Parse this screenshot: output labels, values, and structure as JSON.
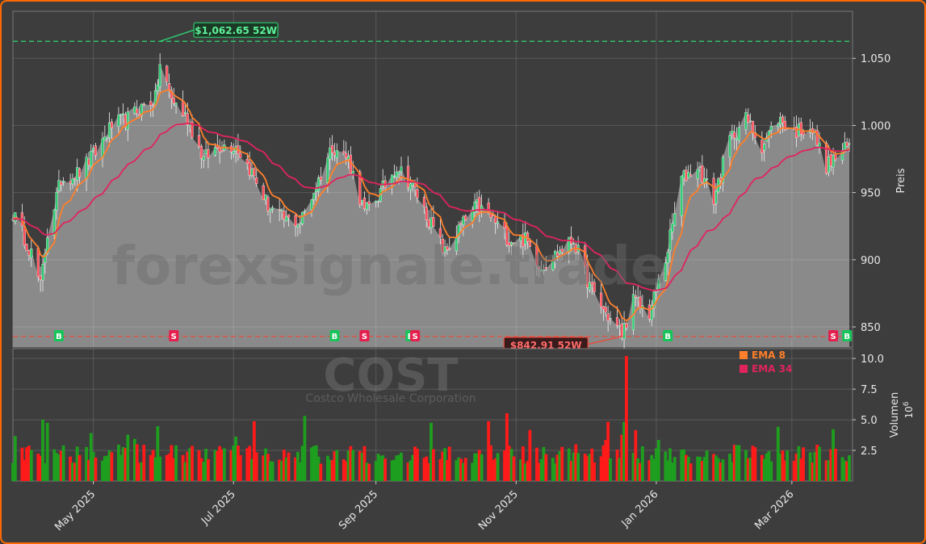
{
  "chart_data": {
    "type": "candlestick",
    "watermark": "forexsignale.trade",
    "ticker": "COST",
    "company": "Costco Wholesale Corporation",
    "price_axis": {
      "label": "Preis",
      "ylim": [
        835,
        1085
      ],
      "ticks": [
        850,
        900,
        950,
        1000,
        1050
      ],
      "tick_labels": [
        "850",
        "900",
        "950",
        "1.000",
        "1.050"
      ]
    },
    "volume_axis": {
      "label": "Volumen",
      "multiplier": "10",
      "multiplier_exp": "6",
      "ylim": [
        0,
        10.8
      ],
      "ticks": [
        2.5,
        5.0,
        7.5,
        10.0
      ],
      "tick_labels": [
        "2.5",
        "5.0",
        "7.5",
        "10.0"
      ]
    },
    "x_axis": {
      "start": "2025-03-27",
      "end": "2026-03-26",
      "ticks": [
        {
          "date": "2025-05-01",
          "label": "May 2025"
        },
        {
          "date": "2025-07-01",
          "label": "Jul 2025"
        },
        {
          "date": "2025-09-01",
          "label": "Sep 2025"
        },
        {
          "date": "2025-11-01",
          "label": "Nov 2025"
        },
        {
          "date": "2026-01-01",
          "label": "Jan 2026"
        },
        {
          "date": "2026-03-01",
          "label": "Mar 2026"
        }
      ]
    },
    "anchors": [
      [
        "2025-03-27",
        935
      ],
      [
        "2025-04-04",
        905
      ],
      [
        "2025-04-08",
        880
      ],
      [
        "2025-04-11",
        920
      ],
      [
        "2025-04-17",
        960
      ],
      [
        "2025-04-25",
        965
      ],
      [
        "2025-05-02",
        980
      ],
      [
        "2025-05-09",
        1000
      ],
      [
        "2025-05-16",
        1005
      ],
      [
        "2025-05-23",
        1015
      ],
      [
        "2025-05-28",
        1020
      ],
      [
        "2025-05-30",
        1045
      ],
      [
        "2025-06-04",
        1020
      ],
      [
        "2025-06-11",
        1005
      ],
      [
        "2025-06-18",
        975
      ],
      [
        "2025-06-25",
        985
      ],
      [
        "2025-07-02",
        985
      ],
      [
        "2025-07-09",
        965
      ],
      [
        "2025-07-16",
        940
      ],
      [
        "2025-07-23",
        930
      ],
      [
        "2025-07-30",
        928
      ],
      [
        "2025-08-06",
        955
      ],
      [
        "2025-08-13",
        985
      ],
      [
        "2025-08-20",
        975
      ],
      [
        "2025-08-27",
        935
      ],
      [
        "2025-09-03",
        950
      ],
      [
        "2025-09-10",
        970
      ],
      [
        "2025-09-17",
        955
      ],
      [
        "2025-09-24",
        930
      ],
      [
        "2025-10-01",
        905
      ],
      [
        "2025-10-08",
        925
      ],
      [
        "2025-10-15",
        940
      ],
      [
        "2025-10-22",
        930
      ],
      [
        "2025-10-29",
        915
      ],
      [
        "2025-11-05",
        915
      ],
      [
        "2025-11-12",
        895
      ],
      [
        "2025-11-19",
        905
      ],
      [
        "2025-11-26",
        915
      ],
      [
        "2025-12-03",
        880
      ],
      [
        "2025-12-10",
        860
      ],
      [
        "2025-12-17",
        845
      ],
      [
        "2025-12-22",
        870
      ],
      [
        "2025-12-29",
        860
      ],
      [
        "2026-01-05",
        900
      ],
      [
        "2026-01-12",
        960
      ],
      [
        "2026-01-19",
        970
      ],
      [
        "2026-01-26",
        945
      ],
      [
        "2026-02-02",
        990
      ],
      [
        "2026-02-09",
        1005
      ],
      [
        "2026-02-16",
        985
      ],
      [
        "2026-02-23",
        1005
      ],
      [
        "2026-03-02",
        995
      ],
      [
        "2026-03-09",
        1000
      ],
      [
        "2026-03-16",
        970
      ],
      [
        "2026-03-23",
        980
      ],
      [
        "2026-03-26",
        985
      ]
    ],
    "series": [
      {
        "name": "EMA 8",
        "color": "#ff7f2a",
        "period": 8
      },
      {
        "name": "EMA 34",
        "color": "#e0245e",
        "period": 34
      }
    ],
    "levels": [
      {
        "label": "$1,062.65 52W",
        "value": 1062.65,
        "date": "2025-05-30",
        "color": "#2ecc71"
      },
      {
        "label": "$842.91 52W",
        "value": 842.91,
        "date": "2025-12-17",
        "color": "#e74c3c"
      }
    ],
    "signals": [
      {
        "date": "2025-04-16",
        "type": "B"
      },
      {
        "date": "2025-06-05",
        "type": "S"
      },
      {
        "date": "2025-08-14",
        "type": "B"
      },
      {
        "date": "2025-08-27",
        "type": "S"
      },
      {
        "date": "2025-09-16",
        "type": "B"
      },
      {
        "date": "2025-09-18",
        "type": "S"
      },
      {
        "date": "2026-01-06",
        "type": "B"
      },
      {
        "date": "2026-03-19",
        "type": "S"
      },
      {
        "date": "2026-03-25",
        "type": "B"
      }
    ],
    "volume_spike": {
      "date": "2025-12-19",
      "value": 10.2
    }
  }
}
